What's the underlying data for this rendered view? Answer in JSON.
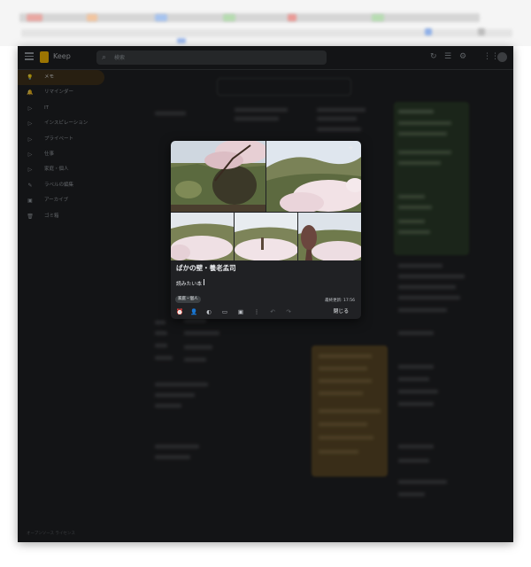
{
  "colors": {
    "app_bg": "#202124",
    "surface": "#3c4043",
    "text_primary": "#e8eaed",
    "text_secondary": "#9aa0a6",
    "active_nav_bg": "#41331c",
    "keep_yellow": "#fbbc04",
    "green_note": "#2c3d2a",
    "brown_note": "#5d4a27"
  },
  "app": {
    "title": "Keep",
    "search_placeholder": "検索"
  },
  "sidebar": {
    "items": [
      {
        "label": "メモ",
        "icon": "lightbulb-icon",
        "active": true
      },
      {
        "label": "リマインダー",
        "icon": "bell-icon"
      },
      {
        "label": "IT",
        "icon": "label-icon"
      },
      {
        "label": "インスピレーション",
        "icon": "label-icon"
      },
      {
        "label": "プライベート",
        "icon": "label-icon"
      },
      {
        "label": "仕事",
        "icon": "label-icon"
      },
      {
        "label": "家庭・個人",
        "icon": "label-icon"
      },
      {
        "label": "ラベルの編集",
        "icon": "pencil-icon"
      },
      {
        "label": "アーカイブ",
        "icon": "archive-icon"
      },
      {
        "label": "ゴミ箱",
        "icon": "trash-icon"
      }
    ],
    "footer": "オープンソース ライセンス"
  },
  "dialog": {
    "title": "ぱかの壁・養老孟司",
    "body": "読みたい本",
    "label": "家庭・個人",
    "edited": "最終更新: 17:56",
    "close_label": "閉じる",
    "toolbar_icons": [
      "remind-icon",
      "collaborator-icon",
      "palette-icon",
      "image-icon",
      "archive-icon",
      "more-icon",
      "undo-icon",
      "redo-icon"
    ]
  }
}
